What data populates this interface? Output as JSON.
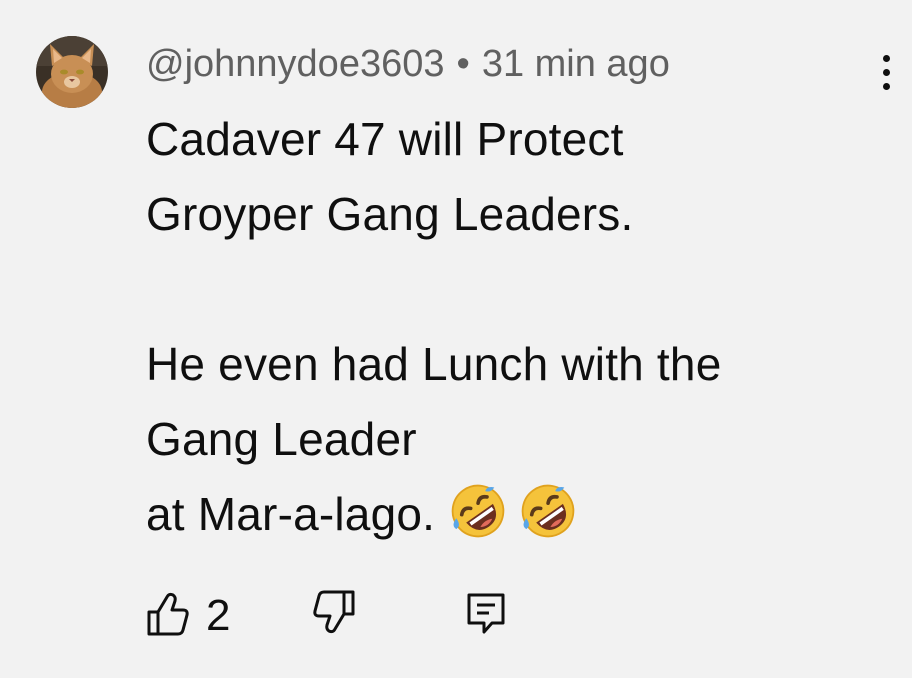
{
  "comment": {
    "author": "@johnnydoe3603",
    "separator": "•",
    "timestamp": "31 min ago",
    "avatar_icon": "cat-avatar",
    "lines": [
      "Cadaver 47 will Protect",
      "Groyper Gang Leaders.",
      "",
      "He even had Lunch with the",
      "Gang Leader",
      "at Mar-a-lago."
    ],
    "emoji": [
      "rolling-on-floor-laughing-emoji",
      "rolling-on-floor-laughing-emoji"
    ],
    "like_count": "2"
  },
  "actions": {
    "like_icon": "thumbs-up-icon",
    "dislike_icon": "thumbs-down-icon",
    "reply_icon": "reply-icon",
    "more_icon": "more-vertical-icon"
  },
  "colors": {
    "background": "#f2f2f2",
    "text": "#0f0f0f",
    "meta": "#606060",
    "emoji_face": "#f5c33b"
  }
}
